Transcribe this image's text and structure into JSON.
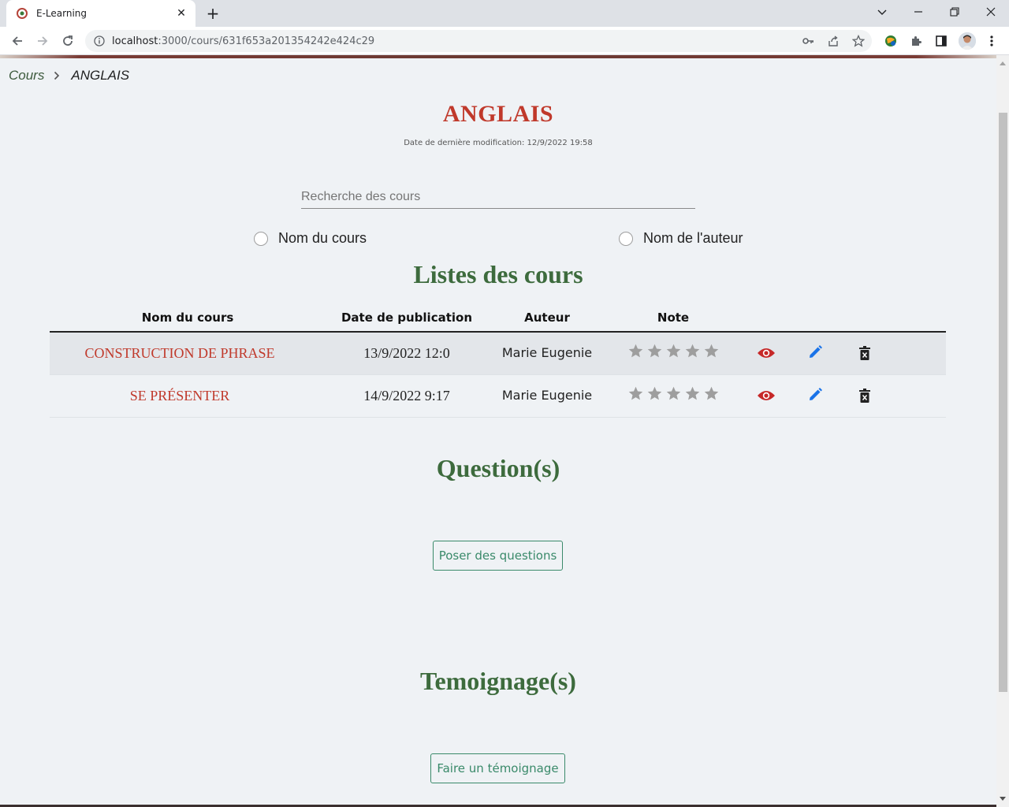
{
  "browser": {
    "tab_title": "E-Learning",
    "tab_close": "✕",
    "new_tab": "+",
    "url_host": "localhost",
    "url_path": ":3000/cours/631f653a201354242e424c29",
    "controls": {
      "minimize": "—",
      "restore": "❐",
      "close": "✕",
      "tabs_menu": "⌄"
    }
  },
  "breadcrumb": {
    "parent": "Cours",
    "current": "ANGLAIS"
  },
  "course": {
    "title": "ANGLAIS",
    "modified": "Date de dernière modification: 12/9/2022 19:58"
  },
  "search": {
    "placeholder": "Recherche des cours",
    "options": [
      "Nom du cours",
      "Nom de l'auteur"
    ]
  },
  "list": {
    "title": "Listes des cours",
    "columns": [
      "Nom du cours",
      "Date de publication",
      "Auteur",
      "Note"
    ],
    "rows": [
      {
        "name": "CONSTRUCTION DE PHRASE",
        "date": "13/9/2022 12:0",
        "author": "Marie Eugenie",
        "rating": 0,
        "max_rating": 5
      },
      {
        "name": "SE PRÉSENTER",
        "date": "14/9/2022 9:17",
        "author": "Marie Eugenie",
        "rating": 0,
        "max_rating": 5
      }
    ]
  },
  "questions": {
    "title": "Question(s)",
    "button": "Poser des questions"
  },
  "testimonials": {
    "title": "Temoignage(s)",
    "button": "Faire un témoignage"
  },
  "colors": {
    "title_red": "#c0392b",
    "section_green": "#3d6b3d",
    "button_green": "#3a8a6a",
    "view_icon": "#c62828",
    "edit_icon": "#1a73e8",
    "delete_icon": "#222222",
    "star_empty": "#9e9e9e"
  },
  "icons": {
    "view": "eye-icon",
    "edit": "pencil-icon",
    "delete": "trash-icon",
    "rating": "star-icon"
  }
}
